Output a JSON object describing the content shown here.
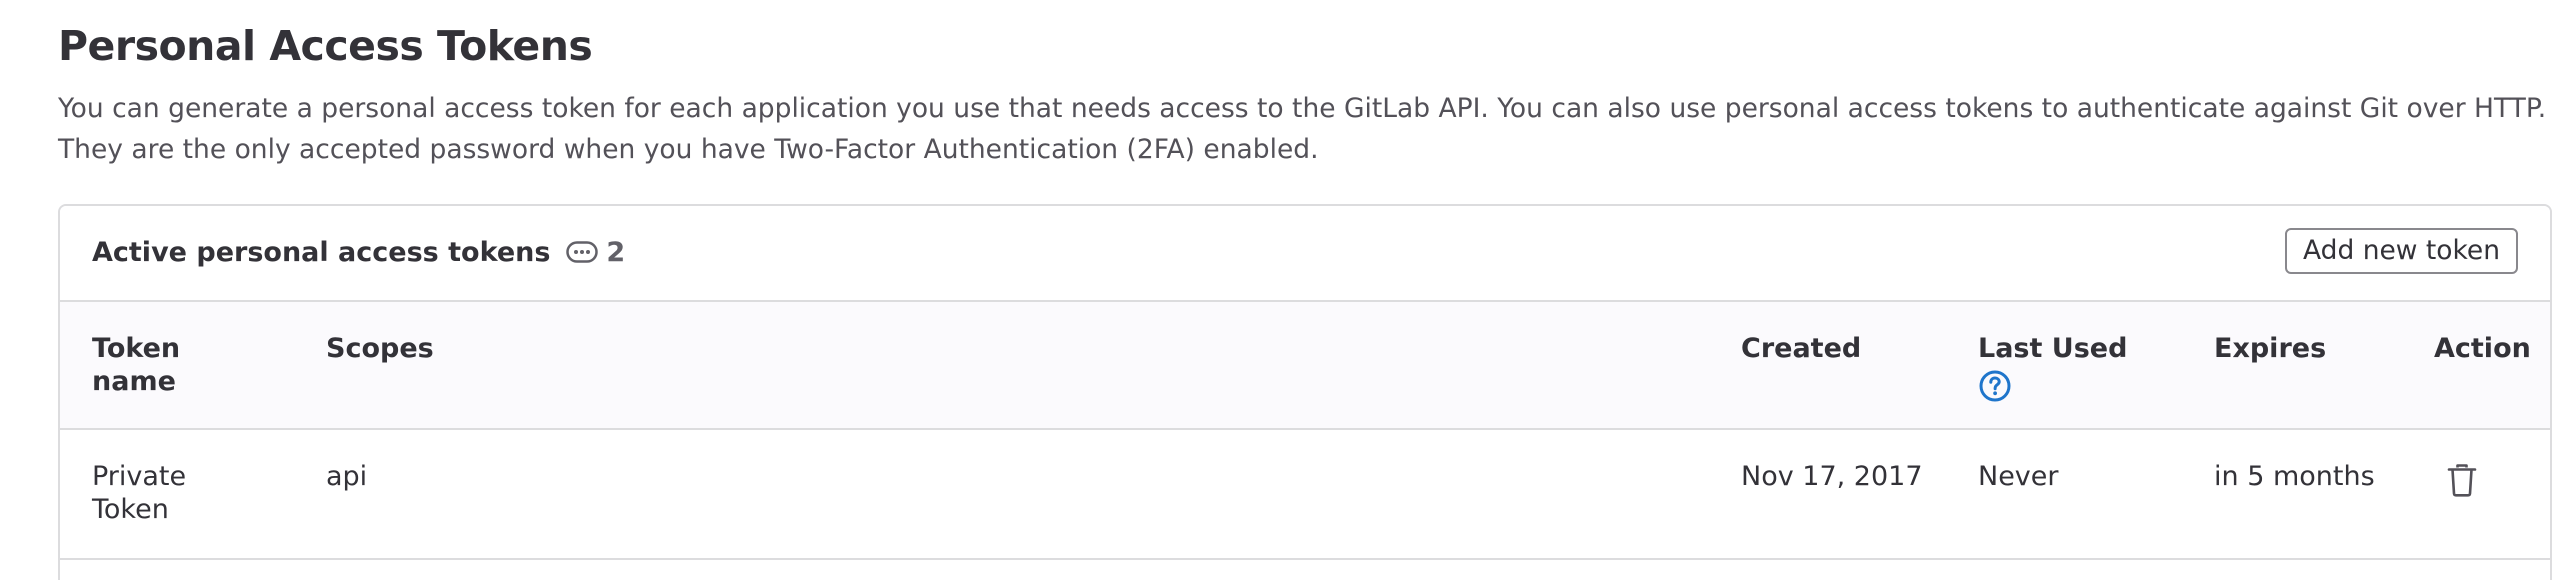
{
  "page": {
    "title": "Personal Access Tokens",
    "description_line1": "You can generate a personal access token for each application you use that needs access to the GitLab API. You can also use personal access tokens to authenticate against Git over HTTP.",
    "description_line2": "They are the only accepted password when you have Two-Factor Authentication (2FA) enabled."
  },
  "card": {
    "title": "Active personal access tokens",
    "count_icon": "token-icon",
    "count": "2",
    "add_button_label": "Add new token"
  },
  "table": {
    "columns": {
      "name": "Token name",
      "scopes": "Scopes",
      "created": "Created",
      "last_used": "Last Used",
      "expires": "Expires",
      "action": "Action"
    },
    "last_used_help_icon": "question-circle-icon",
    "rows": [
      {
        "name": "Private Token",
        "scopes": "api",
        "created": "Nov 17, 2017",
        "last_used": "Never",
        "expires": "in 5 months",
        "action_icon": "trash-icon"
      }
    ]
  },
  "colors": {
    "text": "#333238",
    "muted_text": "#535158",
    "border": "#dcdcde",
    "header_bg": "#fbfafd",
    "help_blue": "#1f75cb"
  }
}
